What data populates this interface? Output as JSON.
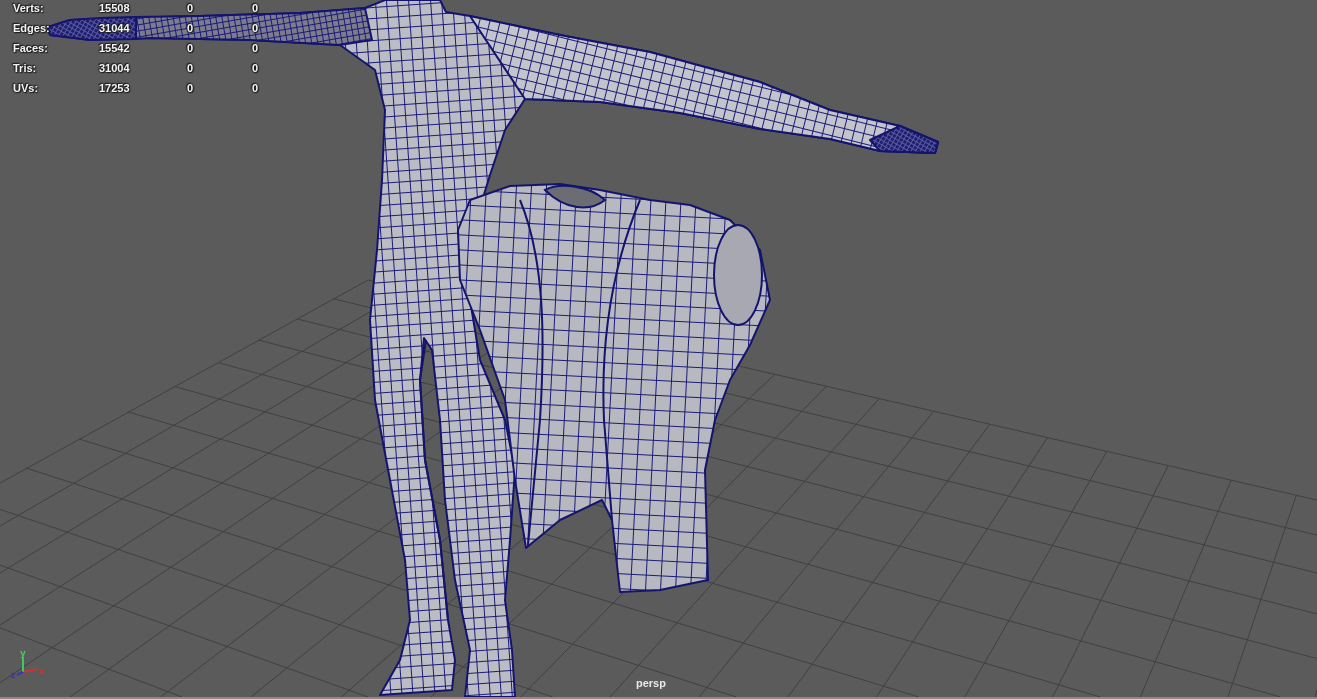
{
  "viewport": {
    "camera": "persp"
  },
  "hud": {
    "rows": [
      {
        "label": "Verts:",
        "values": [
          "15508",
          "0",
          "0"
        ]
      },
      {
        "label": "Edges:",
        "values": [
          "31044",
          "0",
          "0"
        ]
      },
      {
        "label": "Faces:",
        "values": [
          "15542",
          "0",
          "0"
        ]
      },
      {
        "label": "Tris:",
        "values": [
          "31004",
          "0",
          "0"
        ]
      },
      {
        "label": "UVs:",
        "values": [
          "17253",
          "0",
          "0"
        ]
      }
    ]
  },
  "axis_indicator": {
    "axes": [
      {
        "kind": "x",
        "label": "x",
        "color": "#c8362c"
      },
      {
        "kind": "y",
        "label": "y",
        "color": "#42c85a"
      },
      {
        "kind": "z",
        "label": "z",
        "color": "#3434c8"
      }
    ]
  }
}
